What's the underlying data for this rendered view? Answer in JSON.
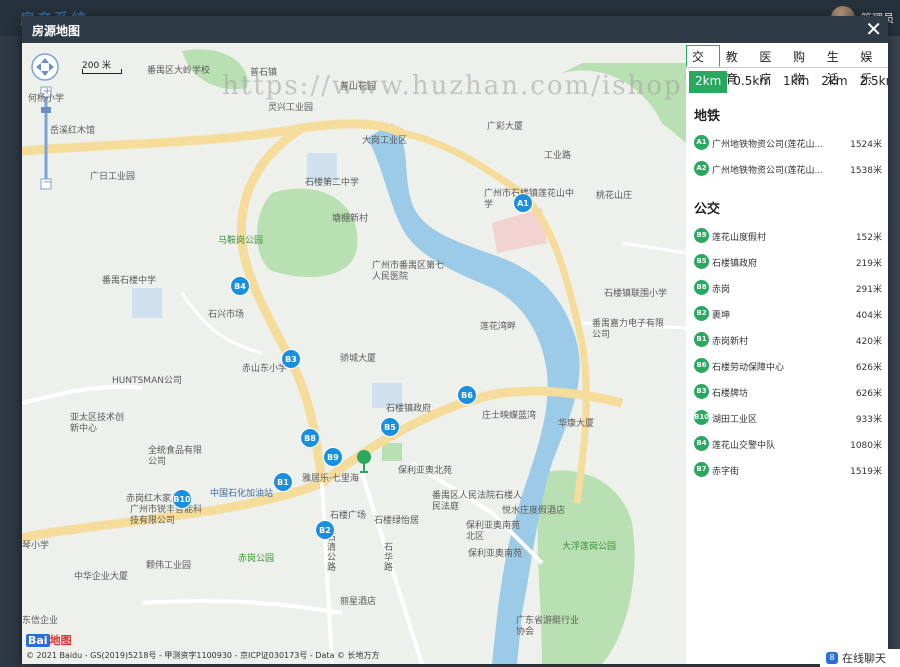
{
  "app": {
    "title": "房产系统",
    "user": "管理员"
  },
  "modal": {
    "title": "房源地图",
    "close": "✕"
  },
  "watermark": "https://www.huzhan.com/ishop70",
  "map": {
    "scale": "200 米",
    "copyright": "© 2021 Baidu - GS(2019)5218号 - 甲测资字1100930 - 京ICP证030173号 - Data © 长地万方",
    "logo_text": "地图",
    "logo_mark": "Bai",
    "zoom_in": "+",
    "zoom_out": "−",
    "labels": [
      "番禺区大岭学校",
      "普石镇",
      "普山花园",
      "何杨小学",
      "岳溪红木馆",
      "灵兴工业园",
      "大岗工业区",
      "广彩大厦",
      "工业路",
      "赤岗新村",
      "广日工业园",
      "石楼第二中学",
      "塘棚新村",
      "广州市石楼镇莲花山中学",
      "桃花山庄",
      "马鞍岗公园",
      "广州市番禺区第七人民医院",
      "番禺石楼中学",
      "石兴市场",
      "石楼镇联围小学",
      "莲花湾畔",
      "番禺嘉力电子有限公司",
      "赤山东小学",
      "骄城大厦",
      "HUNTSMAN公司",
      "亚太区技术创新中心",
      "石楼镇政府",
      "庄士映蝶蓝湾",
      "华康大厦",
      "全统食品有限公司",
      "雅居乐·七里海",
      "保利亚奥北苑",
      "赤岗红木家具",
      "中国石化加油站",
      "广州市锐丰智能科技有限公司",
      "石楼广场",
      "番禺区人民法院石楼人民法庭",
      "悦水庄度假酒店",
      "石楼绿怡居",
      "保利亚奥南苑北区",
      "赤岗公园",
      "大浮莲岗公园",
      "颗伟工业园",
      "保利亚奥南苑",
      "中华企业大厦",
      "丽星酒店",
      "广东省游艇行业协会",
      "市桥水道",
      "石清公路",
      "石华路",
      "琴小学",
      "东信企业"
    ],
    "stops": [
      "A1",
      "B4",
      "B3",
      "B6",
      "B5",
      "B8",
      "B9",
      "B1",
      "B10",
      "B2"
    ]
  },
  "panel": {
    "categories": [
      "交通",
      "教育",
      "医疗",
      "购物",
      "生活",
      "娱乐"
    ],
    "active_category": "交通",
    "distances": [
      "2km",
      "0.5km",
      "1km",
      "2km",
      "2.5km"
    ],
    "active_distance": "2km",
    "subway_title": "地铁",
    "subway": [
      {
        "code": "A1",
        "name": "广州地铁物资公司(莲花山...",
        "dist": "1524米"
      },
      {
        "code": "A2",
        "name": "广州地铁物资公司(莲花山...",
        "dist": "1538米"
      }
    ],
    "bus_title": "公交",
    "bus": [
      {
        "code": "B9",
        "name": "莲花山度假村",
        "dist": "152米"
      },
      {
        "code": "B5",
        "name": "石楼镇政府",
        "dist": "219米"
      },
      {
        "code": "B8",
        "name": "赤岗",
        "dist": "291米"
      },
      {
        "code": "B2",
        "name": "裹坤",
        "dist": "404米"
      },
      {
        "code": "B1",
        "name": "赤岗新村",
        "dist": "420米"
      },
      {
        "code": "B6",
        "name": "石楼劳动保障中心",
        "dist": "626米"
      },
      {
        "code": "B3",
        "name": "石楼牌坊",
        "dist": "626米"
      },
      {
        "code": "B10",
        "name": "湖田工业区",
        "dist": "933米"
      },
      {
        "code": "B4",
        "name": "莲花山交警中队",
        "dist": "1080米"
      },
      {
        "code": "B7",
        "name": "赤字街",
        "dist": "1519米"
      }
    ]
  },
  "chat": {
    "label": "在线聊天",
    "icon": "8"
  },
  "colors": {
    "accent": "#2aa860",
    "stop": "#1a8fe0",
    "river": "#9ccbe8",
    "road": "#f6dc9a",
    "park": "#b9e0b2"
  }
}
